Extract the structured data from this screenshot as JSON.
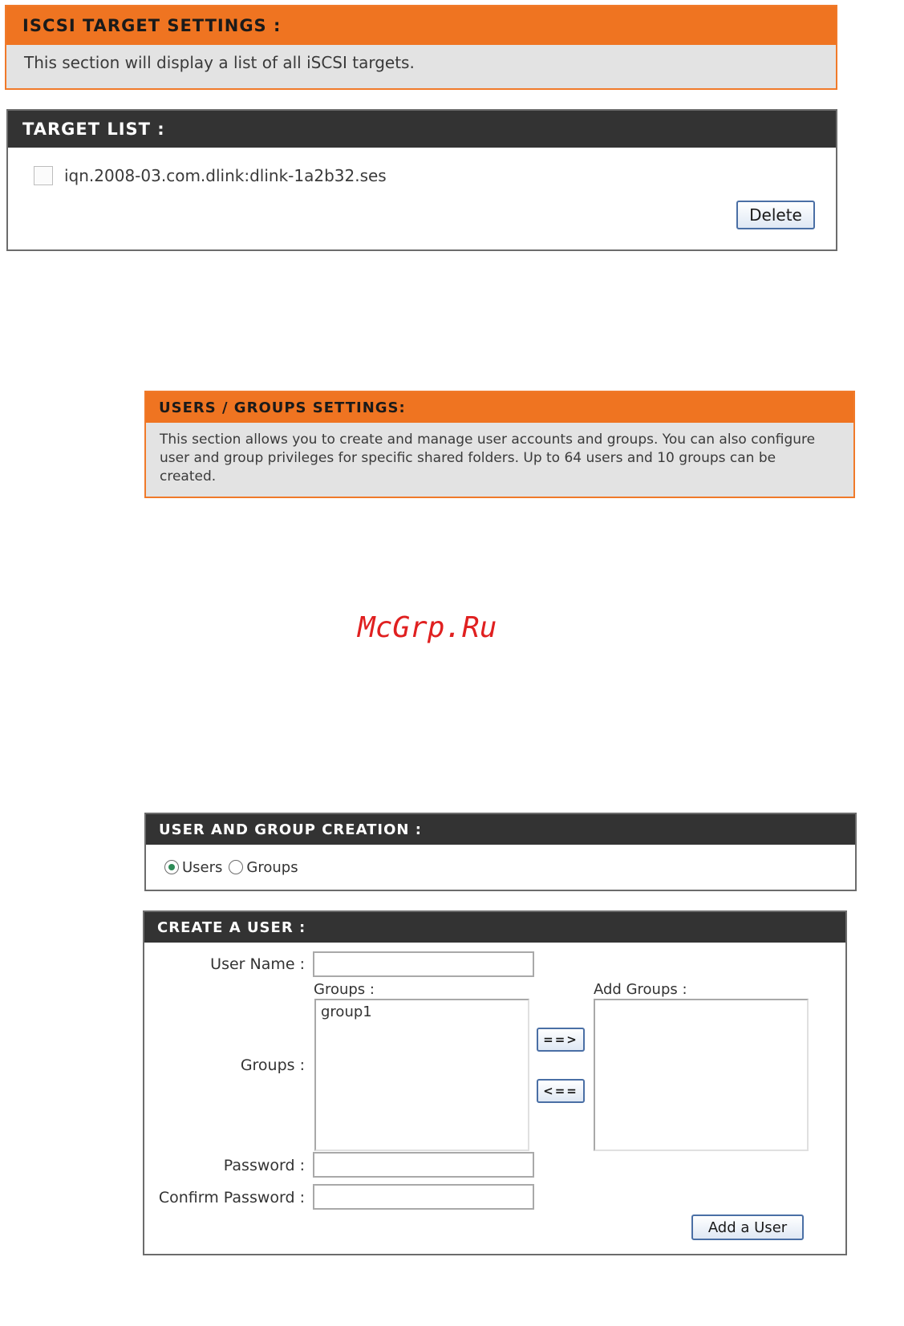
{
  "iscsi_settings": {
    "title": "ISCSI TARGET SETTINGS :",
    "description": "This section will display a list of all iSCSI targets."
  },
  "target_list": {
    "title": "TARGET LIST :",
    "items": [
      {
        "label": "iqn.2008-03.com.dlink:dlink-1a2b32.ses",
        "checked": false
      }
    ],
    "delete_label": "Delete"
  },
  "users_groups_settings": {
    "title": "USERS / GROUPS SETTINGS:",
    "description_lines": [
      "This section allows you to create and manage user accounts and groups. You can also configure",
      "user and group privileges for specific shared folders. Up to 64 users and 10 groups can be",
      "created."
    ]
  },
  "watermark": "McGrp.Ru",
  "creation": {
    "title": "USER AND GROUP CREATION :",
    "options": [
      {
        "label": "Users",
        "selected": true
      },
      {
        "label": "Groups",
        "selected": false
      }
    ]
  },
  "create_user": {
    "title": "CREATE A USER :",
    "user_name_label": "User Name :",
    "user_name_value": "",
    "groups_label": "Groups :",
    "available_groups_label": "Groups :",
    "available_groups": [
      "group1"
    ],
    "add_arrow_label": "==>",
    "remove_arrow_label": "<==",
    "add_groups_label": "Add Groups :",
    "selected_groups": [],
    "password_label": "Password :",
    "password_value": "",
    "confirm_password_label": "Confirm Password :",
    "confirm_password_value": "",
    "add_user_label": "Add a User"
  },
  "colors": {
    "orange_header": "#ef7421",
    "dark_header": "#333333",
    "panel_gray": "#e3e3e3",
    "watermark_red": "#e02020"
  }
}
